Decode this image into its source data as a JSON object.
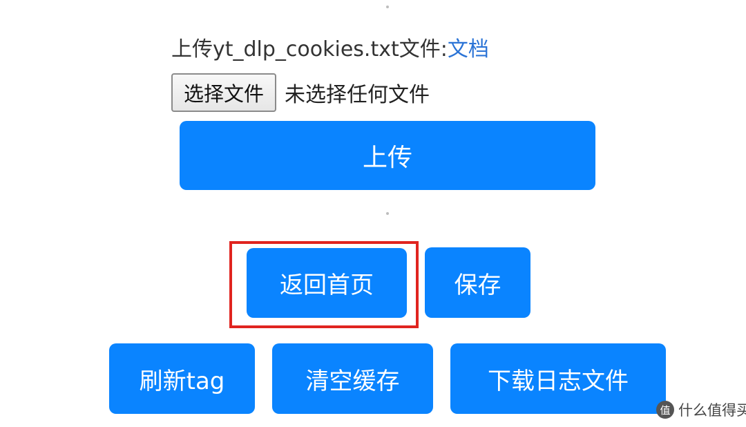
{
  "upload": {
    "label": "上传yt_dlp_cookies.txt文件:",
    "doc_link": "文档",
    "choose_file_button": "选择文件",
    "file_status": "未选择任何文件",
    "upload_button": "上传"
  },
  "actions": {
    "home_button": "返回首页",
    "save_button": "保存",
    "refresh_tag_button": "刷新tag",
    "clear_cache_button": "清空缓存",
    "download_log_button": "下载日志文件"
  },
  "watermark": {
    "icon_glyph": "值",
    "text": "什么值得买"
  },
  "colors": {
    "button_blue": "#0a84ff",
    "link_blue": "#2a73d6",
    "highlight_red": "#e0241f"
  }
}
